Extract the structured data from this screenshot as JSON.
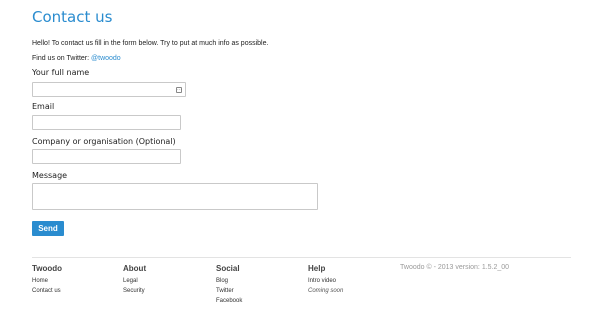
{
  "page": {
    "title": "Contact us"
  },
  "intro": {
    "text": "Hello! To contact us fill in the form below. Try to put at much info as possible.",
    "twitter_prefix": "Find us on Twitter: ",
    "twitter_handle": "@twoodo"
  },
  "form": {
    "full_name": {
      "label": "Your full name",
      "value": ""
    },
    "email": {
      "label": "Email",
      "value": ""
    },
    "company": {
      "label": "Company or organisation (Optional)",
      "value": ""
    },
    "message": {
      "label": "Message",
      "value": ""
    },
    "send_label": "Send"
  },
  "footer": {
    "columns": [
      {
        "heading": "Twoodo",
        "links": [
          "Home",
          "Contact us"
        ]
      },
      {
        "heading": "About",
        "links": [
          "Legal",
          "Security"
        ]
      },
      {
        "heading": "Social",
        "links": [
          "Blog",
          "Twitter",
          "Facebook"
        ]
      },
      {
        "heading": "Help",
        "links": [
          "Intro video",
          "Coming soon"
        ]
      }
    ],
    "copyright": "Twoodo © - 2013 version: 1.5.2_00"
  },
  "colors": {
    "accent": "#2a8ccf"
  }
}
